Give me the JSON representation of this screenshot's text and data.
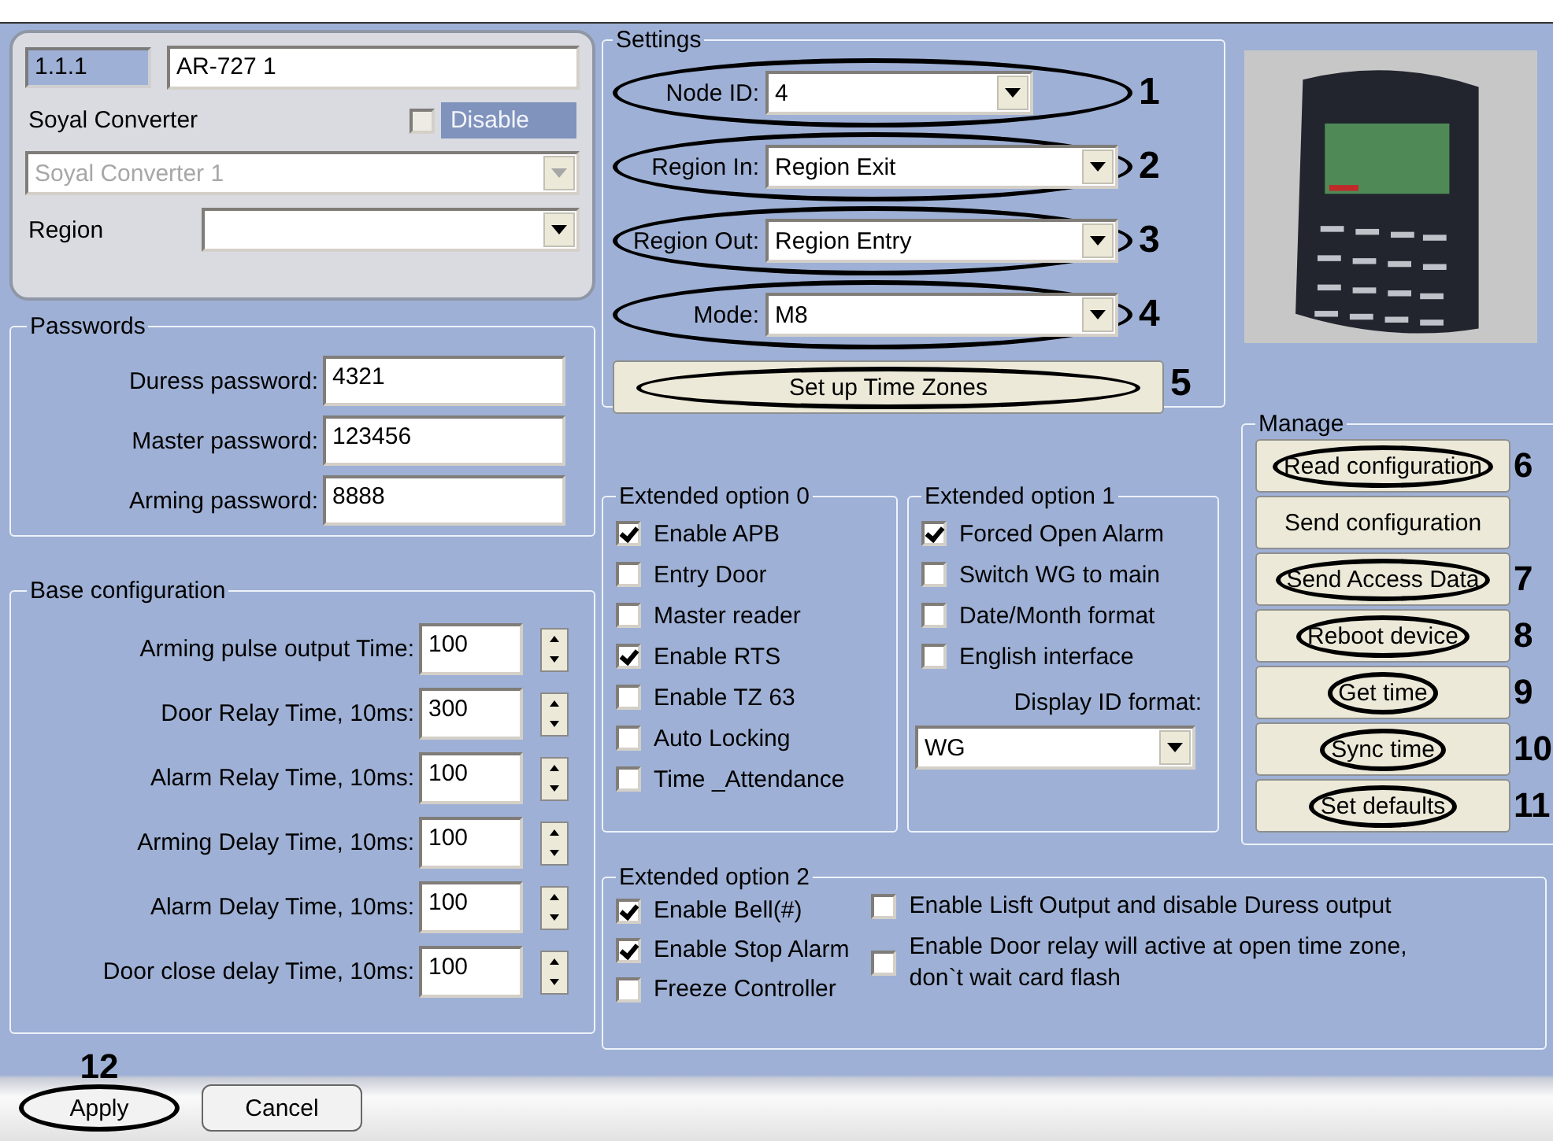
{
  "device": {
    "address": "1.1.1",
    "name": "AR-727 1",
    "converter_label": "Soyal Converter",
    "disable": {
      "label": "Disable",
      "checked": false,
      "disabled": true
    },
    "converter": {
      "value": "Soyal Converter 1",
      "disabled": true
    },
    "region": {
      "label": "Region"
    }
  },
  "passwords": {
    "title": "Passwords",
    "fields": [
      {
        "label": "Duress password:",
        "value": "4321"
      },
      {
        "label": "Master password:",
        "value": "123456"
      },
      {
        "label": "Arming password:",
        "value": "8888"
      }
    ]
  },
  "base_configuration": {
    "title": "Base configuration",
    "fields": [
      {
        "label": "Arming pulse output Time:",
        "value": "100"
      },
      {
        "label": "Door Relay Time, 10ms:",
        "value": "300"
      },
      {
        "label": "Alarm Relay Time, 10ms:",
        "value": "100"
      },
      {
        "label": "Arming Delay Time, 10ms:",
        "value": "100"
      },
      {
        "label": "Alarm Delay Time, 10ms:",
        "value": "100"
      },
      {
        "label": "Door close delay Time, 10ms:",
        "value": "100"
      }
    ]
  },
  "settings": {
    "title": "Settings",
    "fields": [
      {
        "label": "Node ID:",
        "value": "4",
        "callout": "1"
      },
      {
        "label": "Region In:",
        "value": "Region Exit",
        "callout": "2"
      },
      {
        "label": "Region Out:",
        "value": "Region Entry",
        "callout": "3"
      },
      {
        "label": "Mode:",
        "value": "M8",
        "callout": "4"
      }
    ],
    "button": {
      "label": "Set up Time Zones",
      "callout": "5"
    }
  },
  "extended_option_0": {
    "title": "Extended option 0",
    "options": [
      {
        "label": "Enable APB",
        "checked": true
      },
      {
        "label": "Entry Door",
        "checked": false
      },
      {
        "label": "Master reader",
        "checked": false
      },
      {
        "label": "Enable RTS",
        "checked": true
      },
      {
        "label": "Enable TZ 63",
        "checked": false
      },
      {
        "label": "Auto Locking",
        "checked": false
      },
      {
        "label": "Time _Attendance",
        "checked": false
      }
    ]
  },
  "extended_option_1": {
    "title": "Extended option 1",
    "options": [
      {
        "label": "Forced Open Alarm",
        "checked": true
      },
      {
        "label": "Switch WG to main",
        "checked": false
      },
      {
        "label": "Date/Month format",
        "checked": false
      },
      {
        "label": "English interface",
        "checked": false
      }
    ],
    "display_label": "Display ID format:",
    "display_value": "WG"
  },
  "manage": {
    "title": "Manage",
    "buttons": [
      {
        "label": "Read configuration",
        "callout": "6"
      },
      {
        "label": "Send configuration"
      },
      {
        "label": "Send Access Data",
        "callout": "7"
      },
      {
        "label": "Reboot device",
        "callout": "8"
      },
      {
        "label": "Get time",
        "callout": "9"
      },
      {
        "label": "Sync time",
        "callout": "10"
      },
      {
        "label": "Set defaults",
        "callout": "11"
      }
    ]
  },
  "extended_option_2": {
    "title": "Extended option 2",
    "left_options": [
      {
        "label": "Enable Bell(#)",
        "checked": true
      },
      {
        "label": "Enable Stop Alarm",
        "checked": true
      },
      {
        "label": "Freeze Controller",
        "checked": false
      }
    ],
    "right_options": [
      {
        "label": "Enable Lisft Output and disable Duress output",
        "checked": false
      },
      {
        "label": "Enable Door relay will active at open time zone, don`t wait card flash",
        "checked": false
      }
    ]
  },
  "footer": {
    "buttons": [
      {
        "label": "Apply",
        "callout": "12"
      },
      {
        "label": "Cancel"
      }
    ]
  }
}
